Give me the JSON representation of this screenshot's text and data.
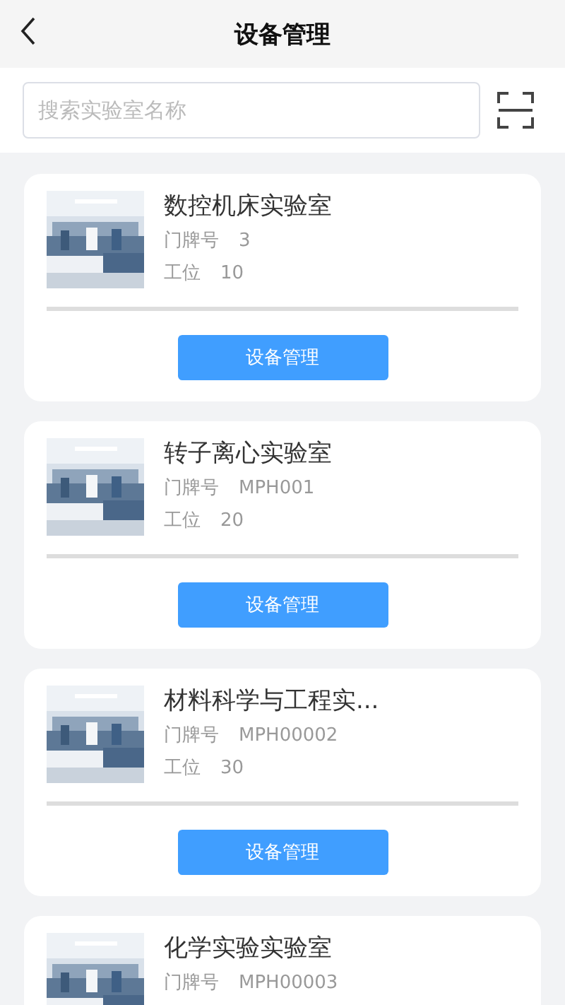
{
  "header": {
    "title": "设备管理"
  },
  "search": {
    "placeholder": "搜索实验室名称"
  },
  "labs": [
    {
      "name": "数控机床实验室",
      "door_label": "门牌号",
      "door": "3",
      "station_label": "工位",
      "station": "10",
      "button": "设备管理"
    },
    {
      "name": "转子离心实验室",
      "door_label": "门牌号",
      "door": "MPH001",
      "station_label": "工位",
      "station": "20",
      "button": "设备管理"
    },
    {
      "name": "材料科学与工程实...",
      "door_label": "门牌号",
      "door": "MPH00002",
      "station_label": "工位",
      "station": "30",
      "button": "设备管理"
    },
    {
      "name": "化学实验实验室",
      "door_label": "门牌号",
      "door": "MPH00003"
    }
  ]
}
